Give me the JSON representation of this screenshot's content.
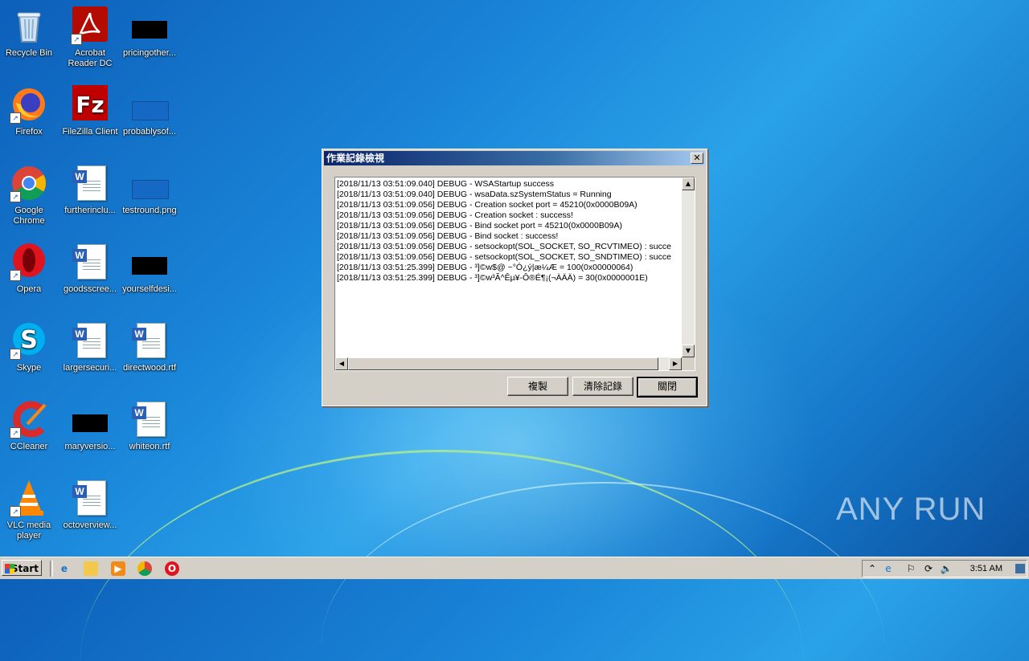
{
  "desktop": {
    "icons": [
      {
        "label": "Recycle Bin",
        "icon": "recycle-bin-icon"
      },
      {
        "label": "Acrobat Reader DC",
        "icon": "acrobat-reader-icon"
      },
      {
        "label": "pricingother...",
        "icon": "image-file-icon"
      },
      {
        "label": "Firefox",
        "icon": "firefox-icon"
      },
      {
        "label": "FileZilla Client",
        "icon": "filezilla-icon"
      },
      {
        "label": "probablysof...",
        "icon": "image-file-icon"
      },
      {
        "label": "Google Chrome",
        "icon": "chrome-icon"
      },
      {
        "label": "furtherinclu...",
        "icon": "word-document-icon"
      },
      {
        "label": "testround.png",
        "icon": "image-file-icon"
      },
      {
        "label": "Opera",
        "icon": "opera-icon"
      },
      {
        "label": "goodsscree...",
        "icon": "word-document-icon"
      },
      {
        "label": "yourselfdesi...",
        "icon": "image-file-icon"
      },
      {
        "label": "Skype",
        "icon": "skype-icon"
      },
      {
        "label": "largersecuri...",
        "icon": "word-document-icon"
      },
      {
        "label": "directwood.rtf",
        "icon": "word-document-icon"
      },
      {
        "label": "CCleaner",
        "icon": "ccleaner-icon"
      },
      {
        "label": "maryversio...",
        "icon": "image-file-icon"
      },
      {
        "label": "whiteon.rtf",
        "icon": "word-document-icon"
      },
      {
        "label": "VLC media player",
        "icon": "vlc-icon"
      },
      {
        "label": "octoverview...",
        "icon": "word-document-icon"
      }
    ]
  },
  "dialog": {
    "title": "作業記錄檢視",
    "close_glyph": "✕",
    "log_lines": [
      "[2018/11/13 03:51:09.040] DEBUG - WSAStartup success",
      "[2018/11/13 03:51:09.040] DEBUG - wsaData.szSystemStatus = Running",
      "[2018/11/13 03:51:09.056] DEBUG - Creation socket port = 45210(0x0000B09A)",
      "[2018/11/13 03:51:09.056] DEBUG - Creation socket : success!",
      "[2018/11/13 03:51:09.056] DEBUG - Bind socket port = 45210(0x0000B09A)",
      "[2018/11/13 03:51:09.056] DEBUG - Bind socket : success!",
      "[2018/11/13 03:51:09.056] DEBUG - setsockopt(SOL_SOCKET, SO_RCVTIMEO) : succe",
      "[2018/11/13 03:51:09.056] DEBUG - setsockopt(SOL_SOCKET, SO_SNDTIMEO) : succe",
      "[2018/11/13 03:51:25.399] DEBUG - ³]©w$@ ~°Ó¿ý|æ¼Æ = 100(0x00000064)",
      "[2018/11/13 03:51:25.399] DEBUG - ³]©w³Ã^Êµ¥-Ô®É¶¡(¬ÀÄÄ) = 30(0x0000001E)"
    ],
    "buttons": {
      "copy": "複製",
      "clear": "清除記錄",
      "close": "關閉"
    }
  },
  "watermark": "ANY RUN",
  "taskbar": {
    "start_label": "Start",
    "clock": "3:51 AM",
    "quick_launch": [
      "internet-explorer-icon",
      "explorer-folder-icon",
      "media-player-icon",
      "chrome-icon",
      "opera-icon"
    ],
    "tray": [
      "chevron-up-icon",
      "network-icon",
      "flag-icon",
      "sync-icon",
      "volume-icon",
      "desktop-icon"
    ]
  }
}
